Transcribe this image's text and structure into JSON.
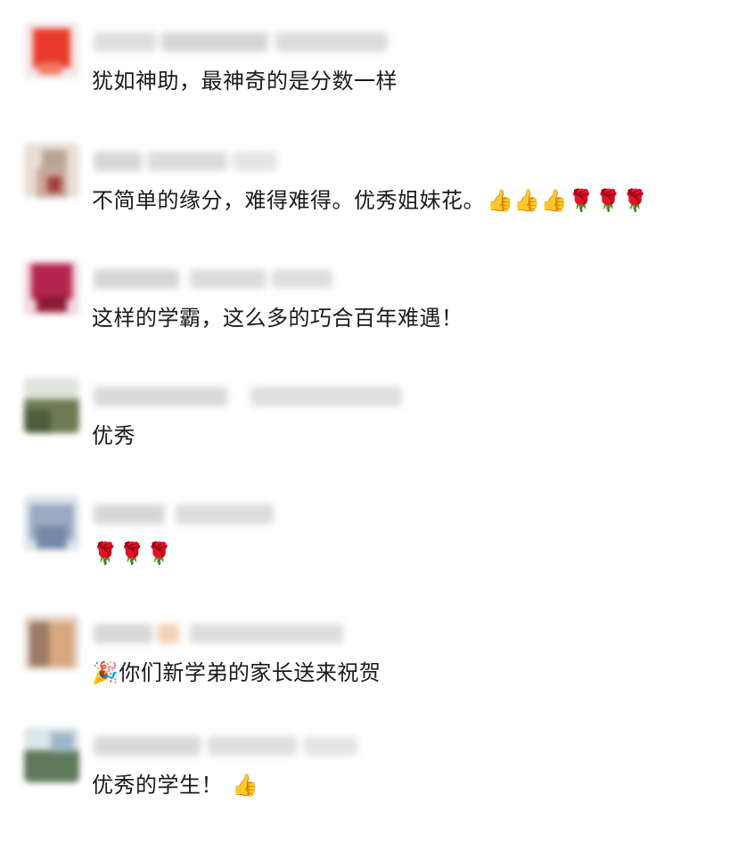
{
  "comments": [
    {
      "text": "犹如神助，最神奇的是分数一样",
      "emoji": ""
    },
    {
      "text": "不简单的缘分，难得难得。优秀姐妹花。",
      "emoji": "👍👍👍🌹🌹🌹"
    },
    {
      "text": "这样的学霸，这么多的巧合百年难遇！",
      "emoji": ""
    },
    {
      "text": "优秀",
      "emoji": ""
    },
    {
      "text": "",
      "emoji": "🌹🌹🌹"
    },
    {
      "text": "你们新学弟的家长送来祝贺",
      "emoji_prefix": "🎉"
    },
    {
      "text": "优秀的学生！",
      "emoji": "👍"
    }
  ]
}
